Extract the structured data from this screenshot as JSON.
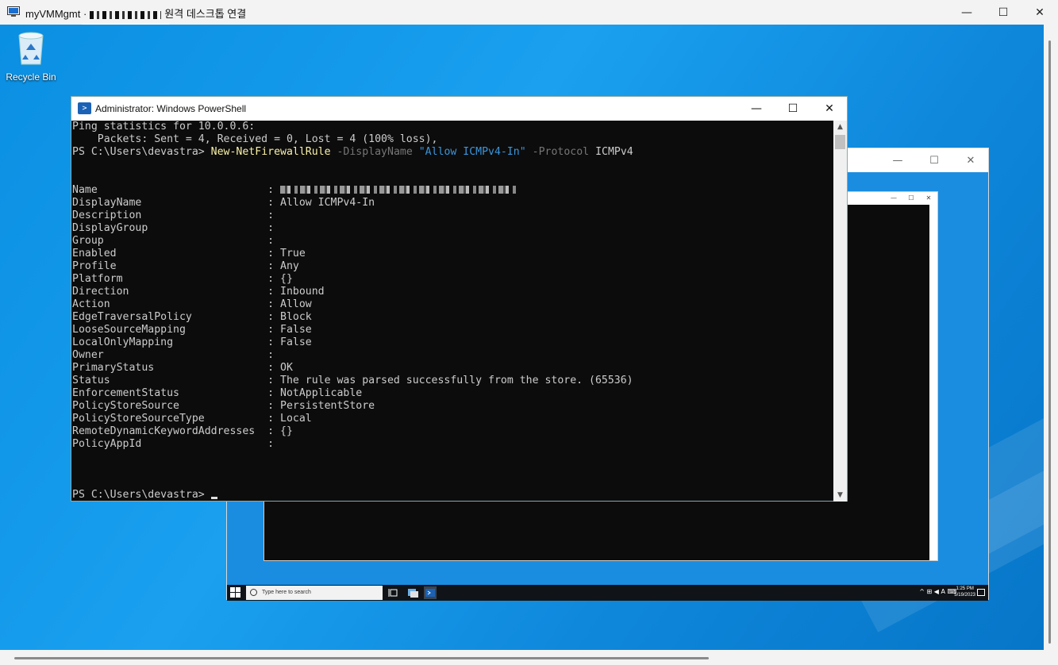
{
  "rdp": {
    "title_prefix": "myVMMgmt ·",
    "title_suffix": "원격 데스크톱 연결",
    "minimize": "—",
    "maximize": "☐",
    "close": "✕"
  },
  "desktop": {
    "recycle_bin_label": "Recycle Bin"
  },
  "inner_window": {
    "minimize": "—",
    "maximize": "☐",
    "close": "✕",
    "nested": {
      "minimize": "—",
      "maximize": "☐",
      "close": "✕"
    }
  },
  "taskbar": {
    "search_placeholder": "Type here to search",
    "tray_icons": "^ ⊞ ◀ A ⌨",
    "clock_time": "1:25 PM",
    "clock_date": "5/19/2023"
  },
  "powershell": {
    "title": "Administrator: Windows PowerShell",
    "minimize": "—",
    "maximize": "☐",
    "close": "✕",
    "ping_header": "Ping statistics for 10.0.0.6:",
    "ping_packets": "    Packets: Sent = 4, Received = 0, Lost = 4 (100% loss),",
    "prompt": "PS C:\\Users\\devastra> ",
    "cmd_name": "New-NetFirewallRule",
    "cmd_param1": "-DisplayName",
    "cmd_value1": "\"Allow ICMPv4-In\"",
    "cmd_param2": "-Protocol",
    "cmd_value2": "ICMPv4",
    "properties": [
      {
        "key": "Name",
        "value": ""
      },
      {
        "key": "DisplayName",
        "value": "Allow ICMPv4-In"
      },
      {
        "key": "Description",
        "value": ""
      },
      {
        "key": "DisplayGroup",
        "value": ""
      },
      {
        "key": "Group",
        "value": ""
      },
      {
        "key": "Enabled",
        "value": "True"
      },
      {
        "key": "Profile",
        "value": "Any"
      },
      {
        "key": "Platform",
        "value": "{}"
      },
      {
        "key": "Direction",
        "value": "Inbound"
      },
      {
        "key": "Action",
        "value": "Allow"
      },
      {
        "key": "EdgeTraversalPolicy",
        "value": "Block"
      },
      {
        "key": "LooseSourceMapping",
        "value": "False"
      },
      {
        "key": "LocalOnlyMapping",
        "value": "False"
      },
      {
        "key": "Owner",
        "value": ""
      },
      {
        "key": "PrimaryStatus",
        "value": "OK"
      },
      {
        "key": "Status",
        "value": "The rule was parsed successfully from the store. (65536)"
      },
      {
        "key": "EnforcementStatus",
        "value": "NotApplicable"
      },
      {
        "key": "PolicyStoreSource",
        "value": "PersistentStore"
      },
      {
        "key": "PolicyStoreSourceType",
        "value": "Local"
      },
      {
        "key": "RemoteDynamicKeywordAddresses",
        "value": "{}"
      },
      {
        "key": "PolicyAppId",
        "value": ""
      }
    ],
    "final_prompt": "PS C:\\Users\\devastra> "
  }
}
